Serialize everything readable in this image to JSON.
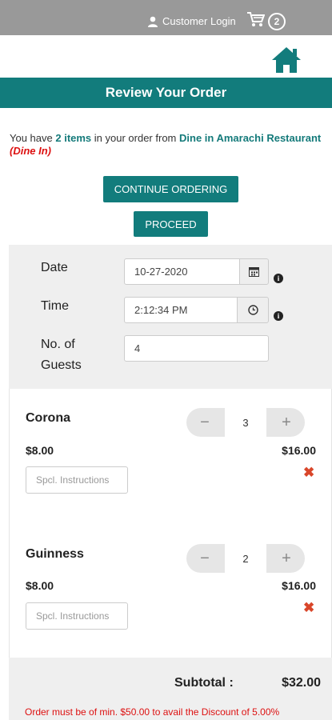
{
  "header": {
    "login_label": "Customer Login",
    "cart_count": "2"
  },
  "title": "Review Your Order",
  "intro": {
    "prefix": "You have ",
    "count": "2 items",
    "middle": " in your order from ",
    "restaurant": "Dine in Amarachi Restaurant",
    "mode": "(Dine In)"
  },
  "buttons": {
    "continue": "CONTINUE ORDERING",
    "proceed": "PROCEED"
  },
  "form": {
    "date_label": "Date",
    "date_value": "10-27-2020",
    "time_label": "Time",
    "time_value": "2:12:34 PM",
    "guests_label_1": "No. of",
    "guests_label_2": "Guests",
    "guests_value": "4",
    "info_glyph": "i"
  },
  "items": [
    {
      "name": "Corona",
      "unit_price": "$8.00",
      "qty": "3",
      "total": "$16.00",
      "instructions_placeholder": "Spcl. Instructions"
    },
    {
      "name": "Guinness",
      "unit_price": "$8.00",
      "qty": "2",
      "total": "$16.00",
      "instructions_placeholder": "Spcl. Instructions"
    }
  ],
  "stepper": {
    "minus": "−",
    "plus": "+"
  },
  "remove_glyph": "✖",
  "summary": {
    "subtotal_label": "Subtotal :",
    "subtotal_value": "$32.00",
    "notice": "Order must be of min. $50.00 to avail the Discount of 5.00%"
  },
  "colors": {
    "topbar": "#999999",
    "brand": "#127c7c",
    "alert": "#dd1111",
    "remove": "#d9462a"
  }
}
